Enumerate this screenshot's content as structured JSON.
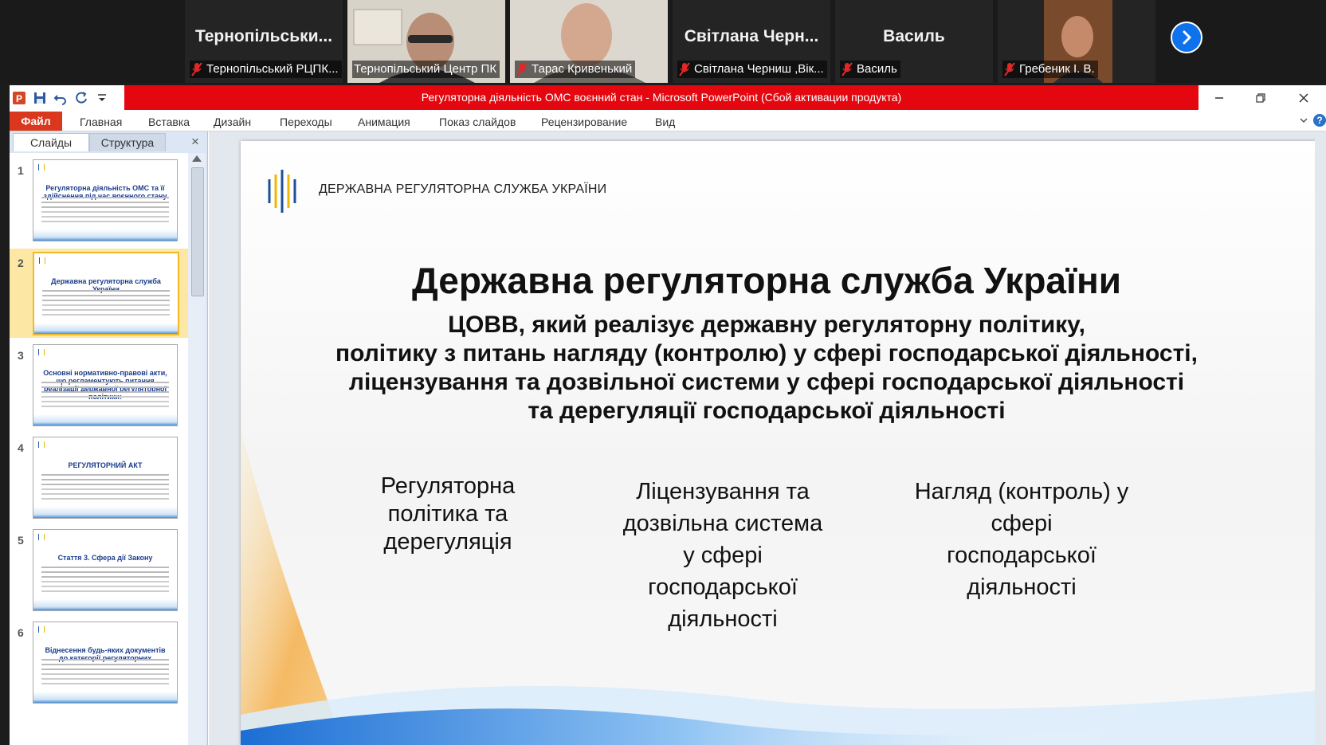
{
  "zoom": {
    "participants": [
      {
        "big_name": "Тернопільськи...",
        "label": "Тернопільський РЦПК...",
        "muted": true
      },
      {
        "big_name": "",
        "label": "Тернопільський Центр ПК",
        "muted": false
      },
      {
        "big_name": "",
        "label": "Тарас Кривенький",
        "muted": true
      },
      {
        "big_name": "Світлана Черн...",
        "label": "Світлана Черниш ,Вік...",
        "muted": true
      },
      {
        "big_name": "Василь",
        "label": "Василь",
        "muted": true
      },
      {
        "big_name": "",
        "label": "Гребеник І. В.",
        "muted": true
      }
    ],
    "next_icon": "chevron-right-icon"
  },
  "window": {
    "title": "Регуляторна діяльність ОМС  воєнний стан  -  Microsoft PowerPoint (Сбой активации продукта)",
    "qat_icons": [
      "powerpoint-icon",
      "save-icon",
      "undo-icon",
      "redo-icon",
      "customize-icon"
    ],
    "controls": [
      "minimize-icon",
      "restore-icon",
      "close-icon"
    ]
  },
  "ribbon": {
    "tabs": [
      "Файл",
      "Главная",
      "Вставка",
      "Дизайн",
      "Переходы",
      "Анимация",
      "Показ слайдов",
      "Рецензирование",
      "Вид"
    ]
  },
  "panel": {
    "tab_slides": "Слайды",
    "tab_outline": "Структура",
    "close_glyph": "×",
    "thumbnails": [
      {
        "num": "1",
        "title": "Регуляторна діяльність ОМС та її здійснення під час воєнного стану"
      },
      {
        "num": "2",
        "title": "Державна регуляторна служба України"
      },
      {
        "num": "3",
        "title": "Основні нормативно-правові акти, що регламентують питання реалізації державної регуляторної політики:"
      },
      {
        "num": "4",
        "title": "РЕГУЛЯТОРНИЙ АКТ"
      },
      {
        "num": "5",
        "title": "Стаття 3. Сфера дії Закону"
      },
      {
        "num": "6",
        "title": "Віднесення будь-яких документів до категорії регуляторних"
      }
    ],
    "selected_index": 1
  },
  "slide": {
    "header": "ДЕРЖАВНА РЕГУЛЯТОРНА СЛУЖБА УКРАЇНИ",
    "title": "Державна регуляторна служба України",
    "subtitle_lines": [
      "ЦОВВ,  який реалізує державну регуляторну політику,",
      "політику з питань нагляду (контролю) у сфері господарської діяльності,",
      "ліцензування та дозвільної системи у сфері господарської діяльності",
      "та дерегуляції господарської діяльності"
    ],
    "columns": [
      [
        "Регуляторна",
        "політика та",
        "дерегуляція"
      ],
      [
        "Ліцензування та",
        "дозвільна система",
        "у сфері",
        "господарської",
        "діяльності"
      ],
      [
        "Нагляд (контроль) у",
        "сфері",
        "господарської",
        "діяльності"
      ]
    ]
  },
  "colors": {
    "title_bar_red": "#e4070f",
    "file_tab": "#d9381e",
    "speaker_border": "#23d959",
    "zoom_blue": "#0e72ed"
  }
}
